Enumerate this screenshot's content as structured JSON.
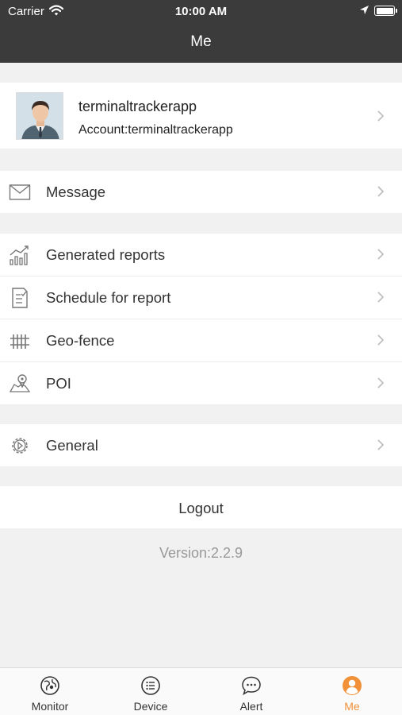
{
  "status": {
    "carrier": "Carrier",
    "time": "10:00 AM"
  },
  "header": {
    "title": "Me"
  },
  "profile": {
    "username": "terminaltrackerapp",
    "account": "Account:terminaltrackerapp"
  },
  "menu": {
    "message": "Message",
    "reports": "Generated reports",
    "schedule": "Schedule for report",
    "geofence": "Geo-fence",
    "poi": "POI",
    "general": "General"
  },
  "logout": "Logout",
  "version": "Version:2.2.9",
  "tabs": [
    {
      "label": "Monitor",
      "icon": "monitor-icon"
    },
    {
      "label": "Device",
      "icon": "device-list-icon"
    },
    {
      "label": "Alert",
      "icon": "alert-chat-icon"
    },
    {
      "label": "Me",
      "icon": "me-person-icon"
    }
  ],
  "colors": {
    "header": "#3b3b3b",
    "active_tab": "#f0913a",
    "background": "#f1f1f1"
  }
}
